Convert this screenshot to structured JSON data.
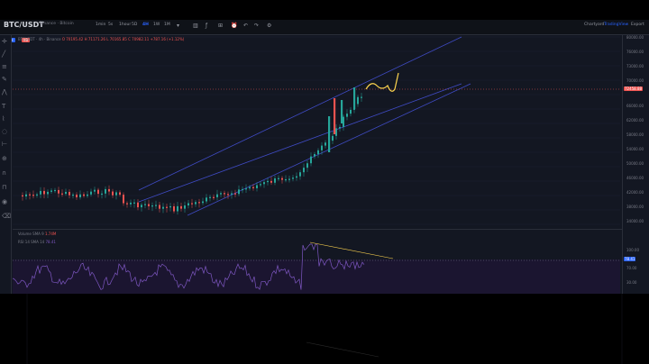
{
  "header": {
    "symbol": "BTC/USDT",
    "exchange": "Binance · Bitcoin",
    "chips": [
      "POH",
      "VB"
    ],
    "timeframes": [
      "1min",
      "5s",
      "1hour",
      "5D",
      "4H",
      "1W",
      "1M"
    ],
    "active_timeframe": "4H",
    "right_links": [
      "Chartyard",
      "TradingView",
      "Export"
    ]
  },
  "legend": {
    "symbol": "BTCUSDT",
    "interval": "4h",
    "source": "Binance",
    "values": "O 70195.42 H 71171.26 L 70165.85 C 70982.11 +787.16 (+1.12%)"
  },
  "price_axis": {
    "ticks": [
      "80000.00",
      "76000.00",
      "73000.00",
      "70000.00",
      "66000.00",
      "62000.00",
      "58000.00",
      "54000.00",
      "50000.00",
      "46000.00",
      "42000.00",
      "38000.00",
      "34000.00"
    ],
    "last_price": "72458.88",
    "indicator_ticks": [
      "100.00",
      "70.00",
      "30.00"
    ],
    "rsi_value": "78.41"
  },
  "indicators": {
    "volume_label": "Volume SMA 9",
    "volume_value": "1.74M",
    "rsi_label": "RSI 14 SMA 14",
    "rsi_value": "78.41"
  },
  "colors": {
    "background": "#131722",
    "up": "#26a69a",
    "down": "#ef5350",
    "channel": "#3f4bc4",
    "projection": "#ffd54f",
    "rsi": "#7e57c2",
    "accent": "#2962ff"
  },
  "icons": [
    "crosshair-icon",
    "trendline-icon",
    "fib-icon",
    "brush-icon",
    "text-icon",
    "measure-icon",
    "zoom-icon",
    "magnet-icon",
    "lock-icon",
    "trash-icon",
    "alert-icon",
    "camera-icon",
    "settings-icon"
  ]
}
